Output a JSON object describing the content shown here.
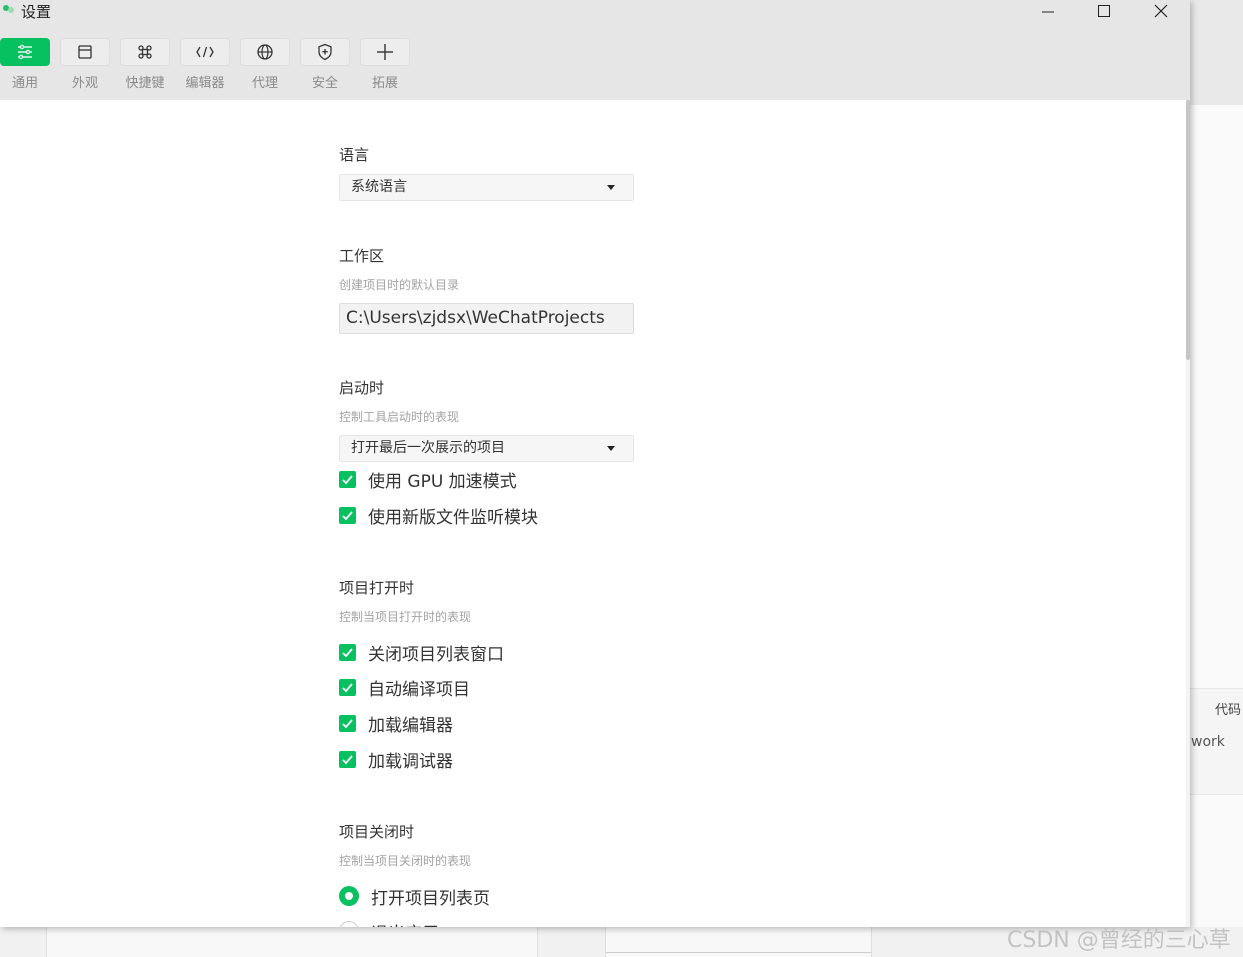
{
  "window": {
    "title": "设置"
  },
  "toolbar": {
    "tabs": [
      {
        "label": "通用",
        "icon": "sliders-icon",
        "active": true
      },
      {
        "label": "外观",
        "icon": "window-layout-icon",
        "active": false
      },
      {
        "label": "快捷键",
        "icon": "command-key-icon",
        "active": false
      },
      {
        "label": "编辑器",
        "icon": "code-icon",
        "active": false
      },
      {
        "label": "代理",
        "icon": "globe-icon",
        "active": false
      },
      {
        "label": "安全",
        "icon": "shield-icon",
        "active": false
      },
      {
        "label": "拓展",
        "icon": "plus-icon",
        "active": false
      }
    ]
  },
  "settings": {
    "language": {
      "title": "语言",
      "value": "系统语言"
    },
    "workspace": {
      "title": "工作区",
      "desc": "创建项目时的默认目录",
      "path": "C:\\Users\\zjdsx\\WeChatProjects"
    },
    "startup": {
      "title": "启动时",
      "desc": "控制工具启动时的表现",
      "value": "打开最后一次展示的项目",
      "checks": [
        {
          "label": "使用 GPU 加速模式",
          "checked": true
        },
        {
          "label": "使用新版文件监听模块",
          "checked": true
        }
      ]
    },
    "project_open": {
      "title": "项目打开时",
      "desc": "控制当项目打开时的表现",
      "checks": [
        {
          "label": "关闭项目列表窗口",
          "checked": true
        },
        {
          "label": "自动编译项目",
          "checked": true
        },
        {
          "label": "加载编辑器",
          "checked": true
        },
        {
          "label": "加载调试器",
          "checked": true
        }
      ]
    },
    "project_close": {
      "title": "项目关闭时",
      "desc": "控制当项目关闭时的表现",
      "options": [
        {
          "label": "打开项目列表页",
          "selected": true
        },
        {
          "label": "退出应用",
          "selected": false
        }
      ]
    }
  },
  "background": {
    "code_tab": "代码",
    "work_text": "work"
  },
  "watermark": "CSDN @曾经的三心草",
  "colors": {
    "accent": "#07c160"
  }
}
